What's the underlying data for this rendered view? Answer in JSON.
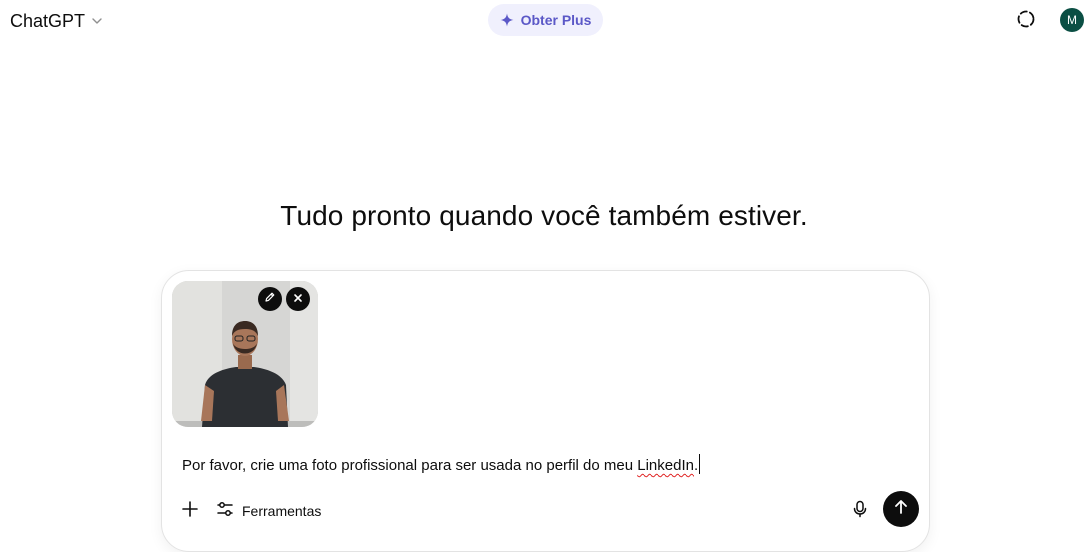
{
  "header": {
    "model_name": "ChatGPT",
    "upgrade_label": "Obter Plus",
    "avatar_initial": "M"
  },
  "main": {
    "heading": "Tudo pronto quando você também estiver."
  },
  "composer": {
    "prompt_before": "Por favor, crie uma foto profissional para ser usada no perfil do meu ",
    "prompt_misspelled": "LinkedIn",
    "prompt_after": ".",
    "tools_label": "Ferramentas",
    "attachment": {
      "description_icon": "image-thumbnail",
      "actions": [
        "edit-icon",
        "close-icon"
      ]
    }
  },
  "colors": {
    "accent": "#5b58c7",
    "upgrade_bg": "#f0f0fd",
    "avatar_bg": "#0b4f44",
    "send_bg": "#0d0d0d"
  },
  "icons": {
    "model_chevron": "chevron-down-icon",
    "upgrade": "sparkle-icon",
    "temporary_chat": "dashed-circle-icon",
    "add": "plus-icon",
    "tools": "sliders-icon",
    "mic": "microphone-icon",
    "send": "arrow-up-icon"
  }
}
